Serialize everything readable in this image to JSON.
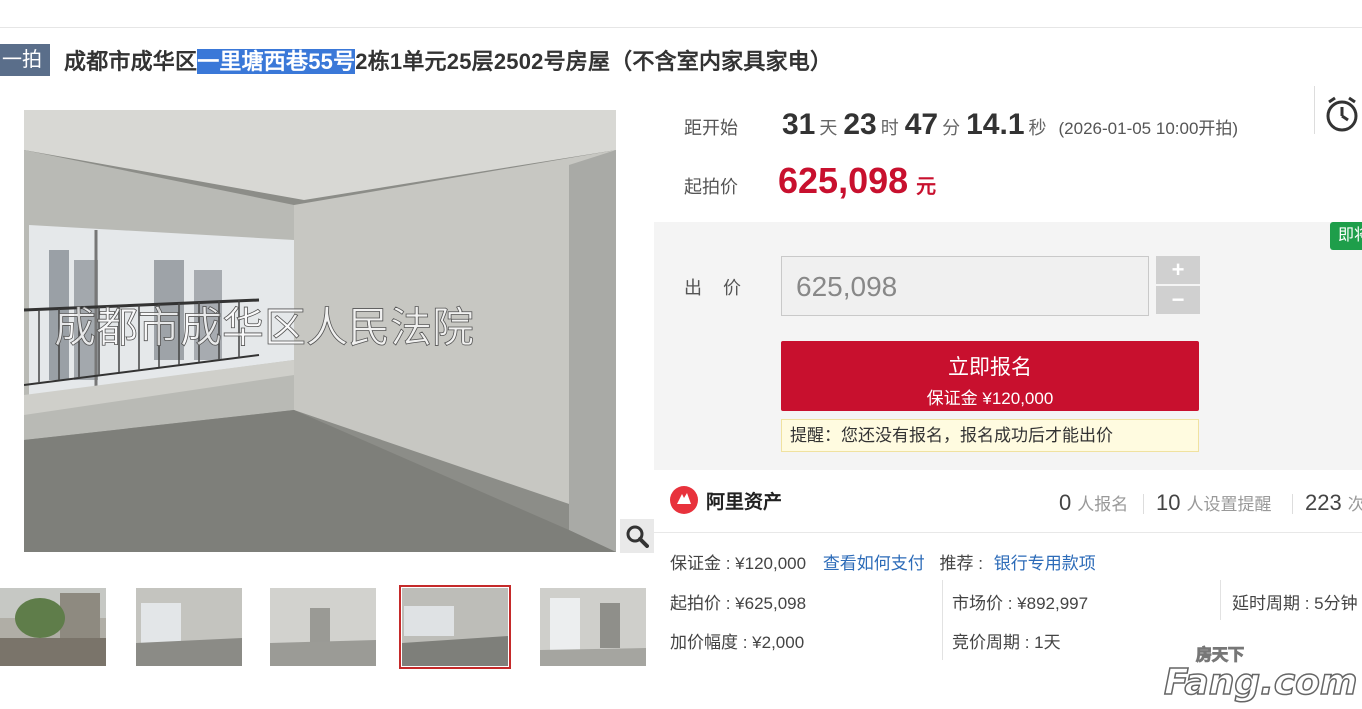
{
  "title": {
    "round_badge": "一拍",
    "prefix": "成都市成华区",
    "highlight": "一里塘西巷55号",
    "suffix": "2栋1单元25层2502号房屋（不含室内家具家电）"
  },
  "image": {
    "watermark_text": "成都市成华区人民法院"
  },
  "countdown": {
    "label": "距开始",
    "days": "31",
    "days_unit": "天",
    "hours": "23",
    "hours_unit": "时",
    "minutes": "47",
    "minutes_unit": "分",
    "seconds": "14.1",
    "seconds_unit": "秒",
    "start_note": "(2026-01-05 10:00开拍)"
  },
  "start_price": {
    "label": "起拍价",
    "value": "625,098",
    "unit": "元"
  },
  "bid": {
    "label": "出 价",
    "input_value": "625,098",
    "plus": "+",
    "minus": "−",
    "register_label": "立即报名",
    "deposit_line": "保证金 ¥120,000",
    "tip": "提醒：您还没有报名，报名成功后才能出价",
    "side_tag": "即将"
  },
  "stats": {
    "brand": "阿里资产",
    "signups_num": "0",
    "signups_label": "人报名",
    "reminders_num": "10",
    "reminders_label": "人设置提醒",
    "views_num": "223",
    "views_label": "次"
  },
  "info": {
    "deposit": "保证金 : ¥120,000",
    "how_to_pay": "查看如何支付",
    "recommend_label": "推荐 :",
    "recommend_link": "银行专用款项",
    "start_price": "起拍价 : ¥625,098",
    "market_price": "市场价 : ¥892,997",
    "delay_period": "延时周期 : 5分钟",
    "increment": "加价幅度 : ¥2,000",
    "bid_period": "竞价周期 : 1天"
  },
  "site_watermark": {
    "line1": "房天下",
    "line2": "Fang.com"
  },
  "colors": {
    "accent_red": "#c8102e",
    "link_blue": "#2c6bb8",
    "highlight_blue": "#3a78d8",
    "badge_slate": "#5a6e8a",
    "green_tag": "#1e9e4a"
  }
}
